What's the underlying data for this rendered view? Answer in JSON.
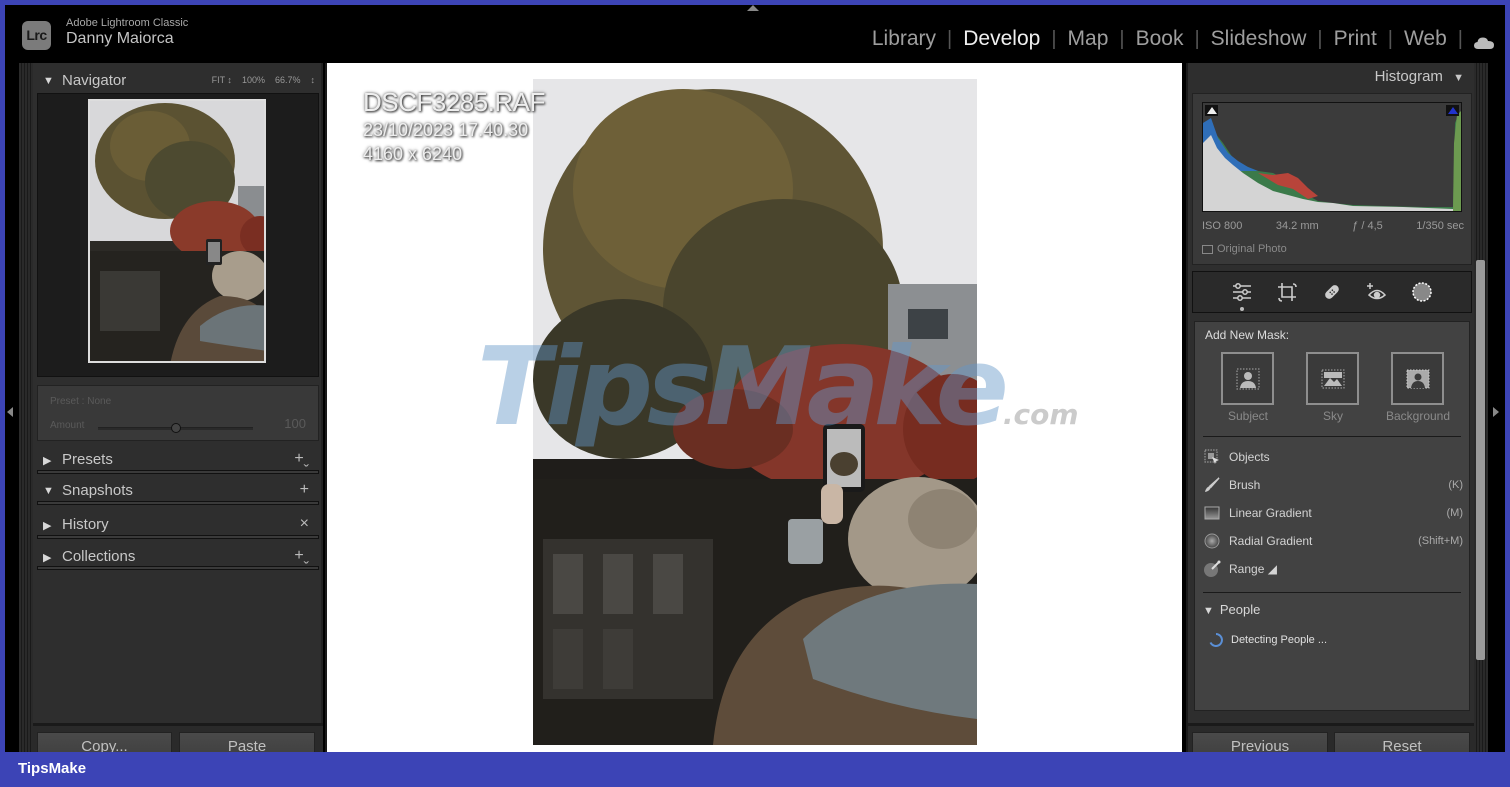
{
  "app": {
    "name": "Adobe Lightroom Classic",
    "logo_text": "Lrc",
    "user": "Danny Maiorca"
  },
  "modules": [
    {
      "label": "Library",
      "active": false
    },
    {
      "label": "Develop",
      "active": true
    },
    {
      "label": "Map",
      "active": false
    },
    {
      "label": "Book",
      "active": false
    },
    {
      "label": "Slideshow",
      "active": false
    },
    {
      "label": "Print",
      "active": false
    },
    {
      "label": "Web",
      "active": false
    }
  ],
  "cloud_icon": "cloud-icon",
  "left_panel": {
    "navigator": {
      "title": "Navigator",
      "zoom_options": [
        "FIT ↕",
        "100%",
        "66.7%",
        "↕"
      ]
    },
    "preset": {
      "label": "Preset : None",
      "amount_label": "Amount",
      "amount_value": "100",
      "amount_fraction": 0.5
    },
    "sections": [
      {
        "title": "Presets",
        "expanded": false,
        "action": "+ˬ"
      },
      {
        "title": "Snapshots",
        "expanded": true,
        "action": "+"
      },
      {
        "title": "History",
        "expanded": false,
        "action": "×"
      },
      {
        "title": "Collections",
        "expanded": false,
        "action": "+ˬ"
      }
    ],
    "copy_label": "Copy...",
    "paste_label": "Paste"
  },
  "center": {
    "filename": "DSCF3285.RAF",
    "datetime": "23/10/2023 17.40.30",
    "dimensions": "4160 x 6240",
    "watermark": "TipsMake",
    "watermark_suffix": ".com"
  },
  "right_panel": {
    "histogram": {
      "title": "Histogram",
      "iso": "ISO 800",
      "focal_length": "34.2 mm",
      "aperture": "ƒ / 4,5",
      "shutter": "1/350 sec",
      "original_photo_label": "Original Photo"
    },
    "tools": [
      {
        "name": "edit-sliders-icon"
      },
      {
        "name": "crop-icon"
      },
      {
        "name": "healing-icon"
      },
      {
        "name": "red-eye-icon"
      },
      {
        "name": "masking-icon"
      }
    ],
    "masking": {
      "title": "Add New Mask:",
      "quick_masks": [
        {
          "label": "Subject"
        },
        {
          "label": "Sky"
        },
        {
          "label": "Background"
        }
      ],
      "items": [
        {
          "label": "Objects",
          "shortcut": ""
        },
        {
          "label": "Brush",
          "shortcut": "(K)"
        },
        {
          "label": "Linear Gradient",
          "shortcut": "(M)"
        },
        {
          "label": "Radial Gradient",
          "shortcut": "(Shift+M)"
        },
        {
          "label": "Range ◢",
          "shortcut": ""
        }
      ],
      "people_title": "People",
      "detecting_label": "Detecting People ..."
    },
    "previous_label": "Previous",
    "reset_label": "Reset"
  },
  "footer": {
    "brand": "TipsMake"
  }
}
